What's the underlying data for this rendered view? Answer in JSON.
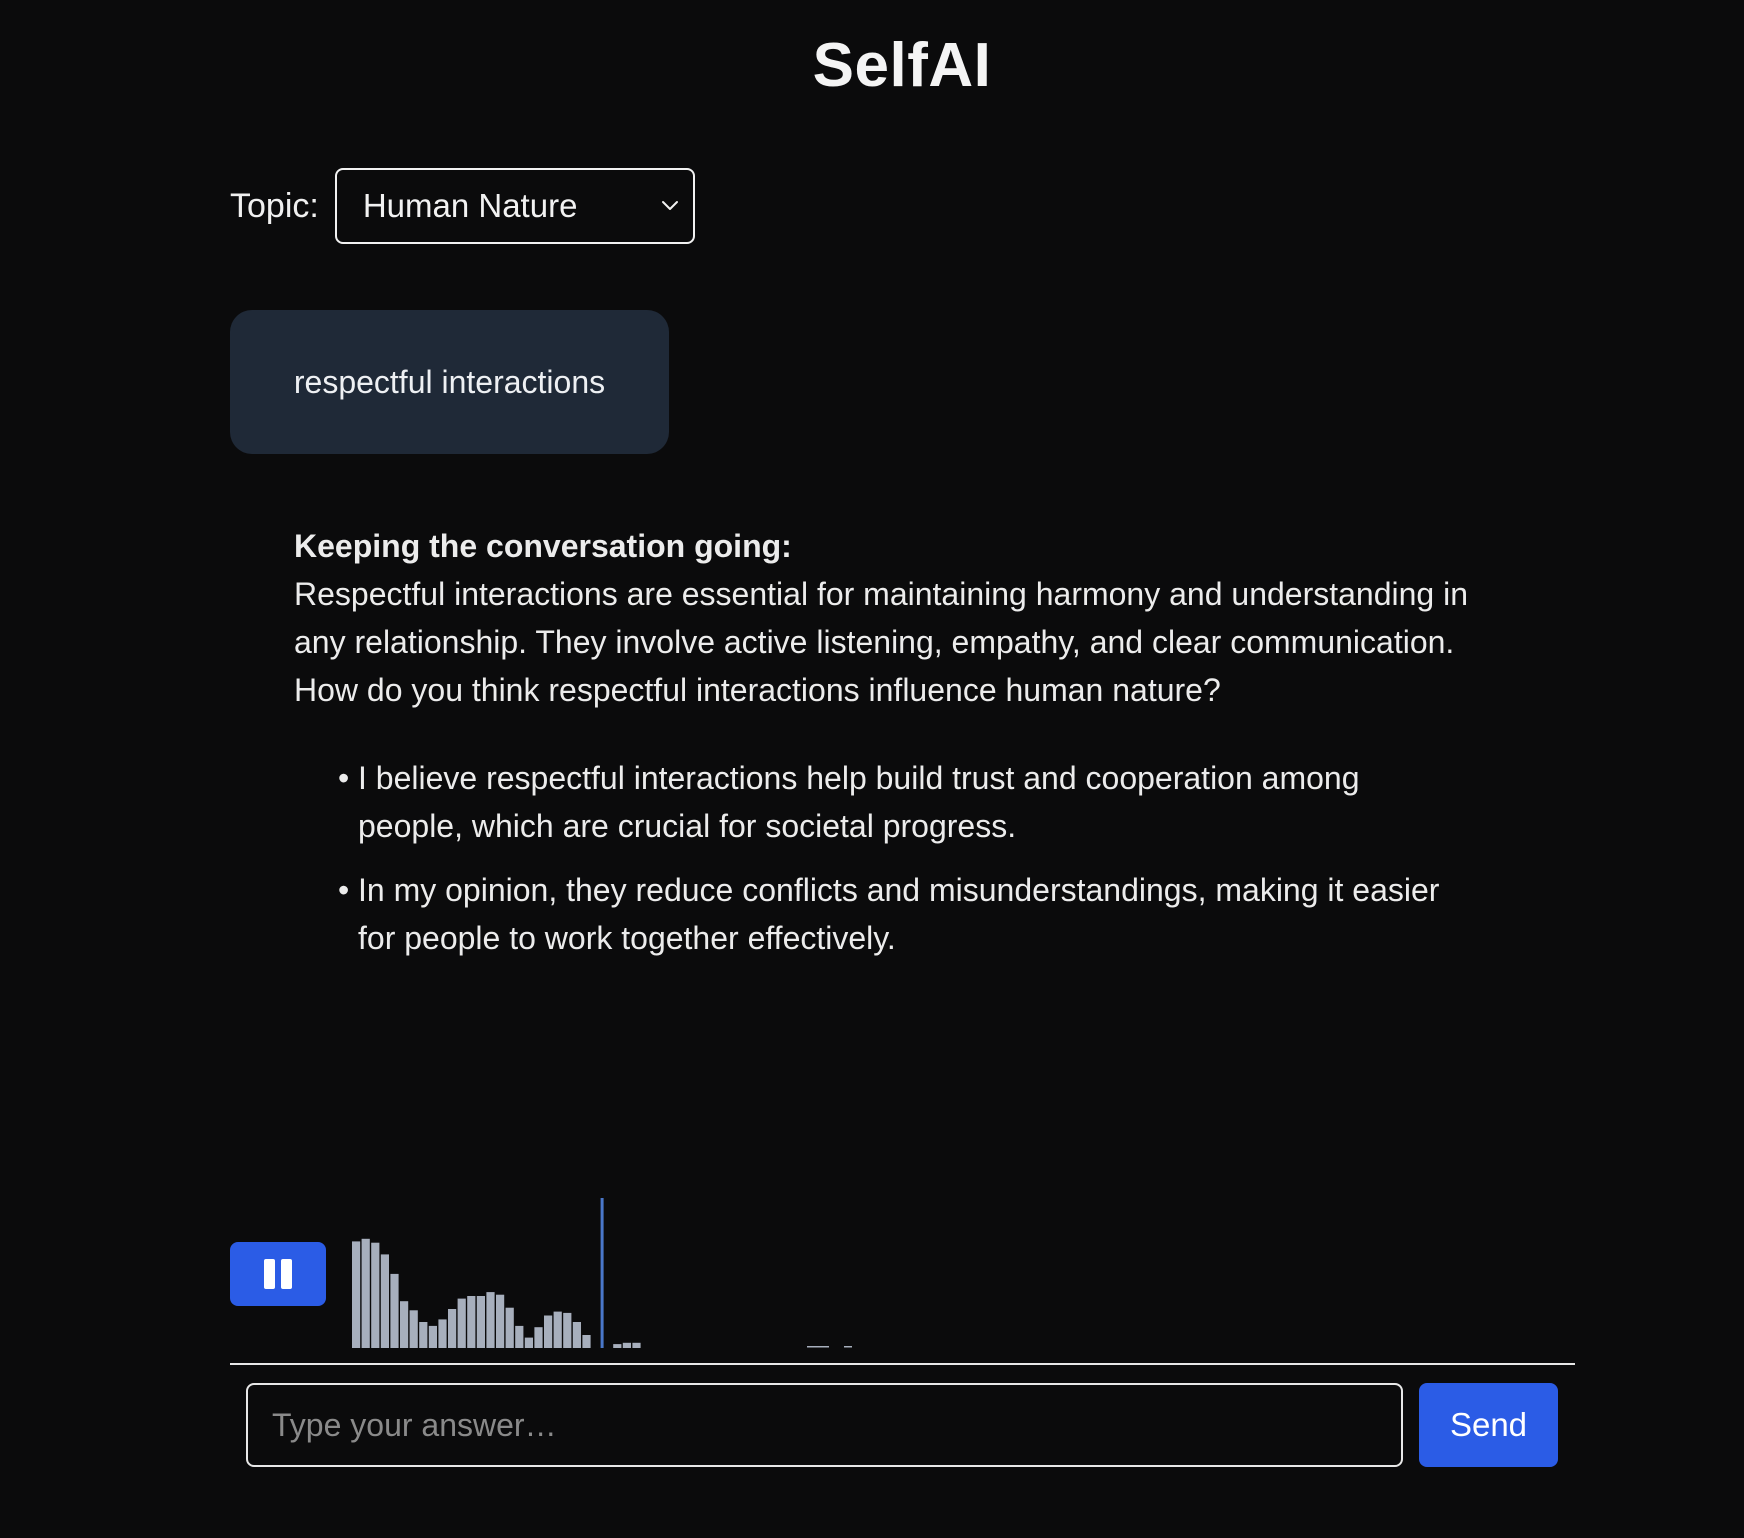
{
  "app": {
    "title": "SelfAI"
  },
  "topic": {
    "label": "Topic:",
    "selected": "Human Nature"
  },
  "user_message": {
    "text": "respectful interactions"
  },
  "assistant_message": {
    "heading": "Keeping the conversation going:",
    "body": "Respectful interactions are essential for maintaining harmony and understanding in any relationship. They involve active listening, empathy, and clear communication. How do you think respectful interactions influence human nature?",
    "suggestions": [
      {
        "text": "I believe respectful interactions help build trust and cooperation among people, which are crucial for societal progress."
      },
      {
        "text": "In my opinion, they reduce conflicts and misunderstandings, making it easier for people to work together effectively."
      }
    ]
  },
  "player": {
    "state_icon": "pause-icon",
    "waveform_levels": [
      0.82,
      0.84,
      0.81,
      0.72,
      0.57,
      0.36,
      0.29,
      0.2,
      0.17,
      0.22,
      0.3,
      0.38,
      0.4,
      0.4,
      0.43,
      0.41,
      0.31,
      0.17,
      0.08,
      0.16,
      0.25,
      0.28,
      0.27,
      0.2,
      0.1,
      0,
      0,
      0.03,
      0.04,
      0.04
    ],
    "playhead_index": 26,
    "colors": {
      "bar": "#a7afbd",
      "playhead": "#4a77c9",
      "button": "#2b5ce6"
    }
  },
  "composer": {
    "placeholder": "Type your answer…",
    "send_label": "Send"
  },
  "colors": {
    "background": "#0b0b0c",
    "user_bubble": "#1f2937",
    "accent": "#2b5ce6"
  }
}
